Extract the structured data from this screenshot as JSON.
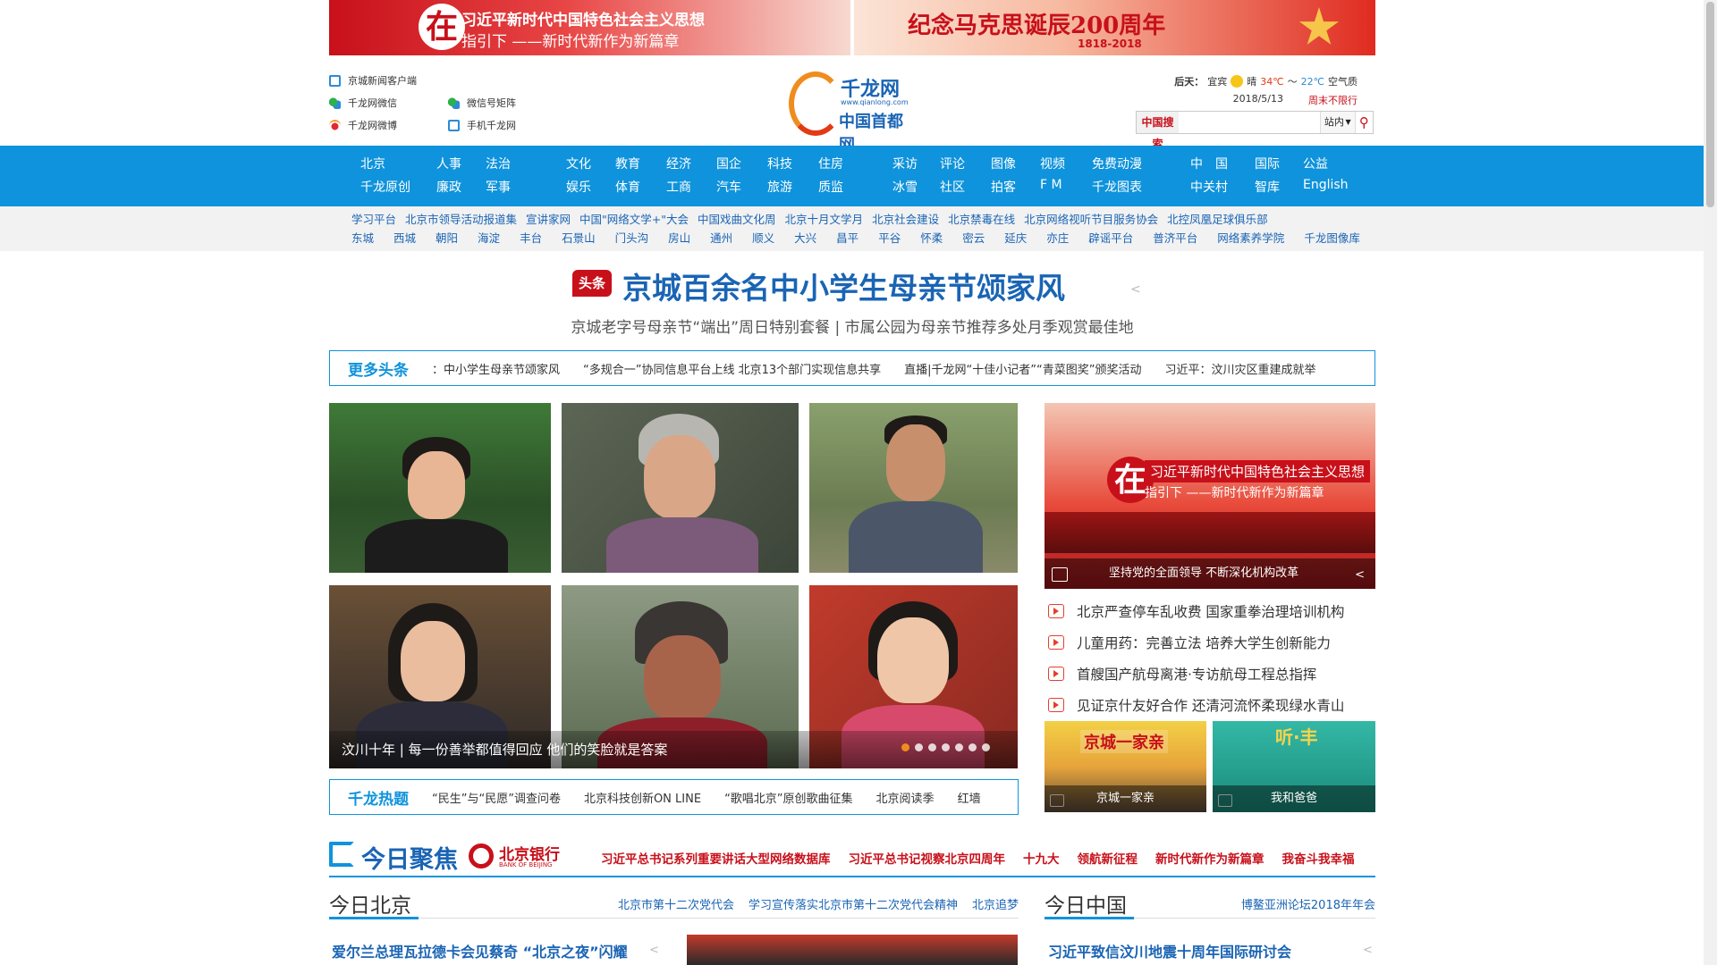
{
  "banners": {
    "left": {
      "char": "在",
      "line1": "习近平新时代中国特色社会主义思想",
      "line2": "指引下 ——新时代新作为新篇章"
    },
    "right": {
      "title": "纪念马克思诞辰200周年",
      "years": "1818-2018"
    }
  },
  "header_links": {
    "client": "京城新闻客户端",
    "wechat": "千龙网微信",
    "weibo": "千龙网微博",
    "wechat_matrix": "微信号矩阵",
    "mobile": "手机千龙网"
  },
  "logo": {
    "name": "千龙网",
    "url": "www.qianlong.com",
    "sub": "中国首都网"
  },
  "weather": {
    "day": "后天：",
    "city": "宜宾",
    "condition": "晴",
    "high": "34℃",
    "sep": "～",
    "low": "22℃",
    "air": "空气质",
    "date": "2018/5/13",
    "restriction": "周末不限行"
  },
  "search": {
    "label": "中国搜索",
    "value": "",
    "scope": "站内",
    "icon": "search-icon"
  },
  "nav": {
    "row1": [
      "北京",
      "人事",
      "法治",
      "文化",
      "教育",
      "经济",
      "国企",
      "科技",
      "住房",
      "采访",
      "评论",
      "图像",
      "视频",
      "免费动漫",
      "中　国",
      "国际",
      "公益"
    ],
    "row2": [
      "千龙原创",
      "廉政",
      "军事",
      "娱乐",
      "体育",
      "工商",
      "汽车",
      "旅游",
      "质监",
      "冰雪",
      "社区",
      "拍客",
      "F M",
      "千龙图表",
      "中关村",
      "智库",
      "English"
    ]
  },
  "subnav": {
    "row1": [
      "学习平台",
      "北京市领导活动报道集",
      "宣讲家网",
      "中国\"网络文学+\"大会",
      "中国戏曲文化周",
      "北京十月文学月",
      "北京社会建设",
      "北京禁毒在线",
      "北京网络视听节目服务协会",
      "北控凤凰足球俱乐部"
    ],
    "row2": [
      "东城",
      "西城",
      "朝阳",
      "海淀",
      "丰台",
      "石景山",
      "门头沟",
      "房山",
      "通州",
      "顺义",
      "大兴",
      "昌平",
      "平谷",
      "怀柔",
      "密云",
      "延庆",
      "亦庄",
      "辟谣平台",
      "普济平台",
      "网络素养学院",
      "千龙图像库"
    ]
  },
  "headline": {
    "badge": "头条",
    "title": "京城百余名中小学生母亲节颂家风",
    "subtitle": "京城老字号母亲节“端出”周日特别套餐 | 市属公园为母亲节推荐多处月季观赏最佳地"
  },
  "more_headlines": {
    "label": "更多头条",
    "items": [
      "：中小学生母亲节颂家风",
      "“多规合一”协同信息平台上线 北京13个部门实现信息共享",
      "直播|千龙网“十佳小记者”“青菜图奖”颁奖活动",
      "习近平：汶川灾区重建成就举"
    ]
  },
  "slideshow": {
    "caption": "汶川十年 | 每一份善举都值得回应 他们的笑脸就是答案",
    "dot_count": 7,
    "active_dot": 0
  },
  "hot": {
    "label": "千龙热题",
    "items": [
      "“民生”与“民愿”调查问卷",
      "北京科技创新ON LINE",
      "“歌唱北京”原创歌曲征集",
      "北京阅读季",
      "红墙"
    ]
  },
  "feature": {
    "char": "在",
    "line1": "习近平新时代中国特色社会主义思想",
    "line2": "指引下 ——新时代新作为新篇章",
    "caption": "坚持党的全面领导 不断深化机构改革"
  },
  "right_news": [
    "北京严查停车乱收费  国家重拳治理培训机构",
    "儿童用药：完善立法  培养大学生创新能力",
    "首艘国产航母离港·专访航母工程总指挥",
    "见证京什友好合作  还清河流怀柔现绿水青山"
  ],
  "thumbs": [
    {
      "caption": "京城一家亲",
      "overlay": "京城一家亲"
    },
    {
      "caption": "我和爸爸",
      "overlay": "听·丰"
    }
  ],
  "focus": {
    "title": "今日聚焦",
    "bank": "北京银行",
    "bank_en": "BANK OF BEIJING",
    "links": [
      "习近平总书记系列重要讲话大型网络数据库",
      "习近平总书记视察北京四周年",
      "十九大",
      "领航新征程",
      "新时代新作为新篇章",
      "我奋斗我幸福"
    ]
  },
  "beijing": {
    "title": "今日北京",
    "links": [
      "北京市第十二次党代会",
      "学习宣传落实北京市第十二次党代会精神",
      "北京追梦"
    ],
    "story": "爱尔兰总理瓦拉德卡会见蔡奇 “北京之夜”闪耀"
  },
  "china": {
    "title": "今日中国",
    "links": [
      "博鳌亚洲论坛2018年年会"
    ],
    "story": "习近平致信汶川地震十周年国际研讨会"
  },
  "colors": {
    "accent": "#0f93dc",
    "brand_red": "#c8101a",
    "link_blue": "#1a64b4"
  }
}
